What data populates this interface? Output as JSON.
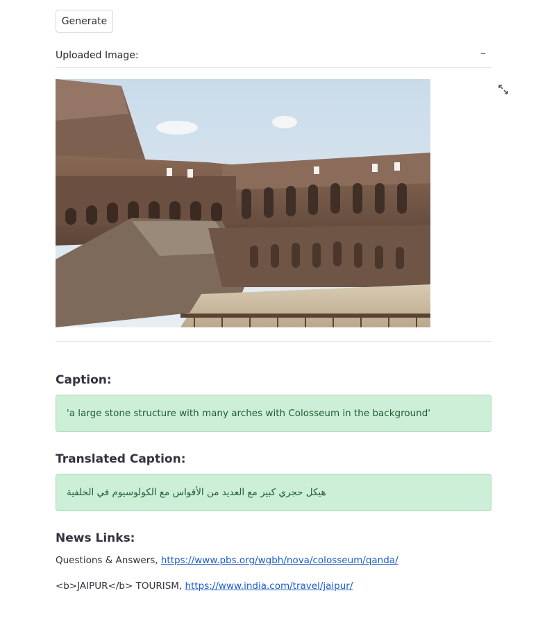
{
  "generate_label": "Generate",
  "expander": {
    "title": "Uploaded Image:",
    "toggle": "–"
  },
  "caption": {
    "heading": "Caption:",
    "text": "'a large stone structure with many arches with Colosseum in the background'"
  },
  "translated": {
    "heading": "Translated Caption:",
    "text": "هيكل حجري كبير مع العديد من الأقواس مع الكولوسيوم في الخلفية"
  },
  "news": {
    "heading": "News Links:",
    "links": [
      {
        "label": "Questions & Answers, ",
        "url": "https://www.pbs.org/wgbh/nova/colosseum/qanda/"
      },
      {
        "label": "<b>JAIPUR</b> TOURISM, ",
        "url": "https://www.india.com/travel/jaipur/"
      }
    ]
  },
  "colors": {
    "alert_bg": "#cdeed7",
    "alert_text": "#1f5f33",
    "link": "#1c5cc9"
  },
  "icons": [
    "fullscreen-icon",
    "minus-icon"
  ]
}
